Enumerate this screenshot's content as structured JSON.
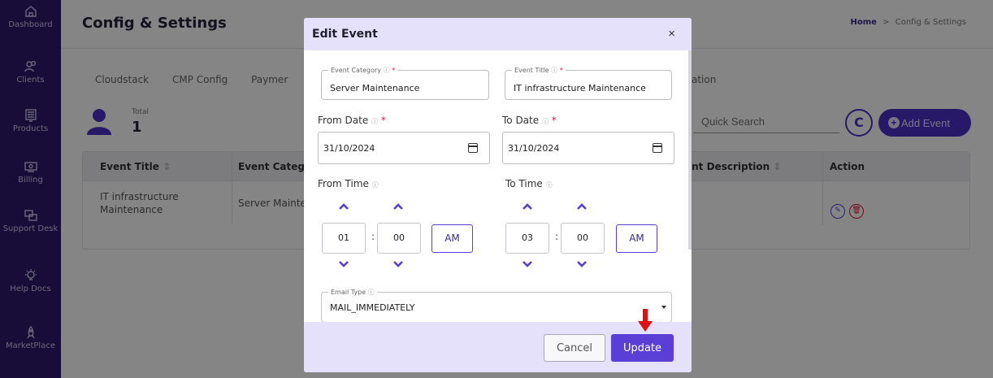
{
  "sidebar": {
    "items": [
      {
        "label": "Dashboard",
        "icon": "home-icon"
      },
      {
        "label": "Clients",
        "icon": "users-icon"
      },
      {
        "label": "Products",
        "icon": "server-icon"
      },
      {
        "label": "Billing",
        "icon": "billing-icon"
      },
      {
        "label": "Support Desk",
        "icon": "support-icon"
      },
      {
        "label": "Help Docs",
        "icon": "bulb-icon"
      },
      {
        "label": "MarketPlace",
        "icon": "rocket-icon"
      }
    ]
  },
  "header": {
    "title": "Config & Settings",
    "breadcrumb_home": "Home",
    "breadcrumb_separator": ">",
    "breadcrumb_current": "Config & Settings"
  },
  "tabs": [
    "Cloudstack",
    "CMP Config",
    "Paymer"
  ],
  "tab_partial_right": "ation",
  "summary": {
    "total_label": "Total",
    "total_value": "1"
  },
  "toolbar": {
    "search_placeholder": "Quick Search",
    "refresh_symbol": "C",
    "add_label": "Add Event"
  },
  "table": {
    "headers": [
      "Event Title",
      "Event Catego",
      "ent Description",
      "Action"
    ],
    "rows": [
      {
        "title": "IT infrastructure Maintenance",
        "category": "Server Mainte"
      }
    ]
  },
  "modal": {
    "title": "Edit Event",
    "close": "×",
    "event_category_label": "Event Category",
    "event_category_value": "Server Maintenance",
    "event_title_label": "Event Title",
    "event_title_value": "IT infrastructure Maintenance",
    "from_date_label": "From Date",
    "from_date_value": "31/10/2024",
    "to_date_label": "To Date",
    "to_date_value": "31/10/2024",
    "from_time_label": "From Time",
    "from_hour": "01",
    "from_minute": "00",
    "from_ampm": "AM",
    "to_time_label": "To Time",
    "to_hour": "03",
    "to_minute": "00",
    "to_ampm": "AM",
    "email_type_label": "Email Type",
    "email_type_value": "MAIL_IMMEDIATELY",
    "cancel_label": "Cancel",
    "update_label": "Update",
    "help_symbol": "?",
    "required_symbol": "*"
  },
  "colors": {
    "sidebar_bg": "#2e1a6b",
    "accent": "#5a3fd6",
    "modal_header_bg": "#e6e1fb",
    "marker": "#e01010"
  }
}
